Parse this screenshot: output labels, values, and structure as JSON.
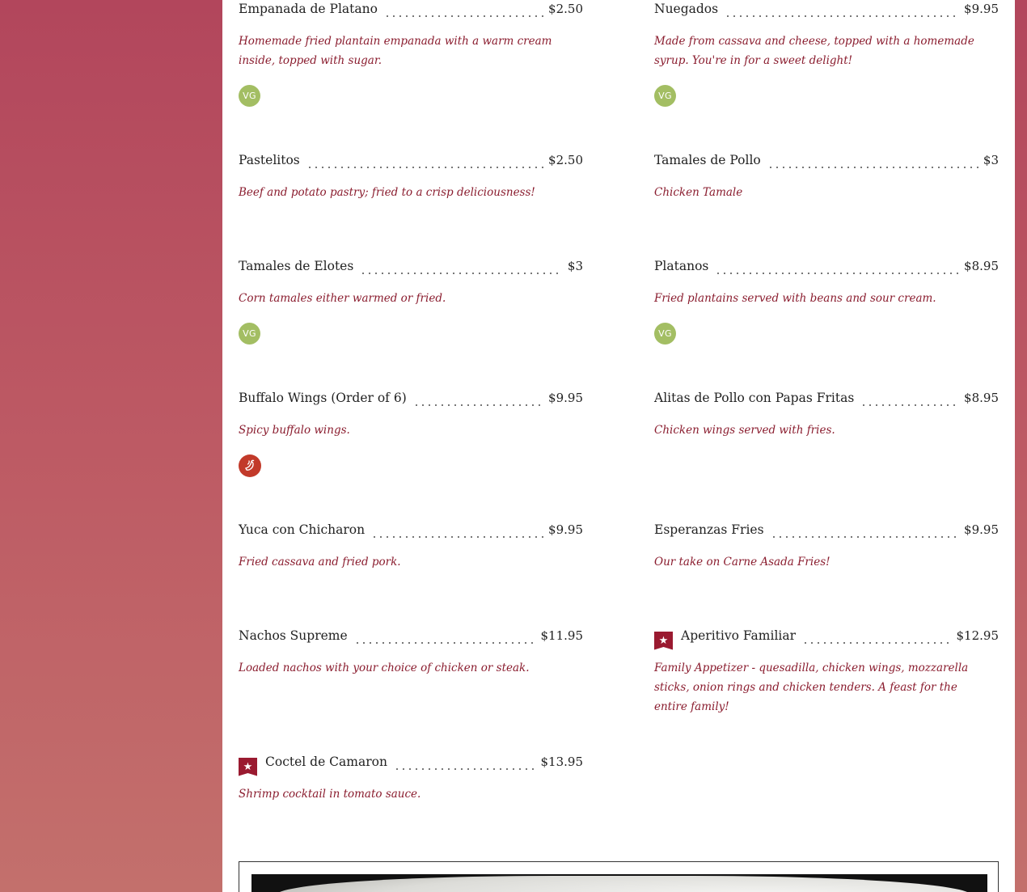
{
  "menu": {
    "items": [
      {
        "name": "Empanada de Platano",
        "price": "$2.50",
        "desc": "Homemade fried plantain empanada with a warm cream inside, topped with sugar.",
        "badge": "VG"
      },
      {
        "name": "Nuegados",
        "price": "$9.95",
        "desc": "Made from cassava and cheese, topped with a homemade syrup. You're in for a sweet delight!",
        "badge": "VG"
      },
      {
        "name": "Pastelitos",
        "price": "$2.50",
        "desc": "Beef and potato pastry; fried to a crisp deliciousness!"
      },
      {
        "name": "Tamales de Pollo",
        "price": "$3",
        "desc": "Chicken Tamale"
      },
      {
        "name": "Tamales de Elotes",
        "price": "$3",
        "desc": "Corn tamales either warmed or fried.",
        "badge": "VG"
      },
      {
        "name": "Platanos",
        "price": "$8.95",
        "desc": "Fried plantains served with beans and sour cream.",
        "badge": "VG"
      },
      {
        "name": "Buffalo Wings (Order of 6)",
        "price": "$9.95",
        "desc": "Spicy buffalo wings.",
        "badge_icon": "chili-pepper-icon"
      },
      {
        "name": "Alitas de Pollo con Papas Fritas",
        "price": "$8.95",
        "desc": "Chicken wings served with fries."
      },
      {
        "name": "Yuca con Chicharon",
        "price": "$9.95",
        "desc": "Fried cassava and fried pork."
      },
      {
        "name": "Esperanzas Fries",
        "price": "$9.95",
        "desc": "Our take on Carne Asada Fries!"
      },
      {
        "name": "Nachos Supreme",
        "price": "$11.95",
        "desc": "Loaded nachos with your choice of chicken or steak."
      },
      {
        "name": "Aperitivo Familiar",
        "price": "$12.95",
        "desc": "Family Appetizer - quesadilla, chicken wings, mozzarella sticks, onion rings and chicken tenders. A feast for the entire family!",
        "featured_icon": "star-flag-icon"
      },
      {
        "name": "Coctel de Camaron",
        "price": "$13.95",
        "desc": "Shrimp cocktail in tomato sauce.",
        "featured_icon": "star-flag-icon"
      }
    ]
  },
  "colors": {
    "accent": "#8a1c2e",
    "vegan_badge": "#a3be63",
    "spicy_badge": "#c23a2a",
    "background_top": "#b2465c",
    "background_bottom": "#c3706c"
  }
}
